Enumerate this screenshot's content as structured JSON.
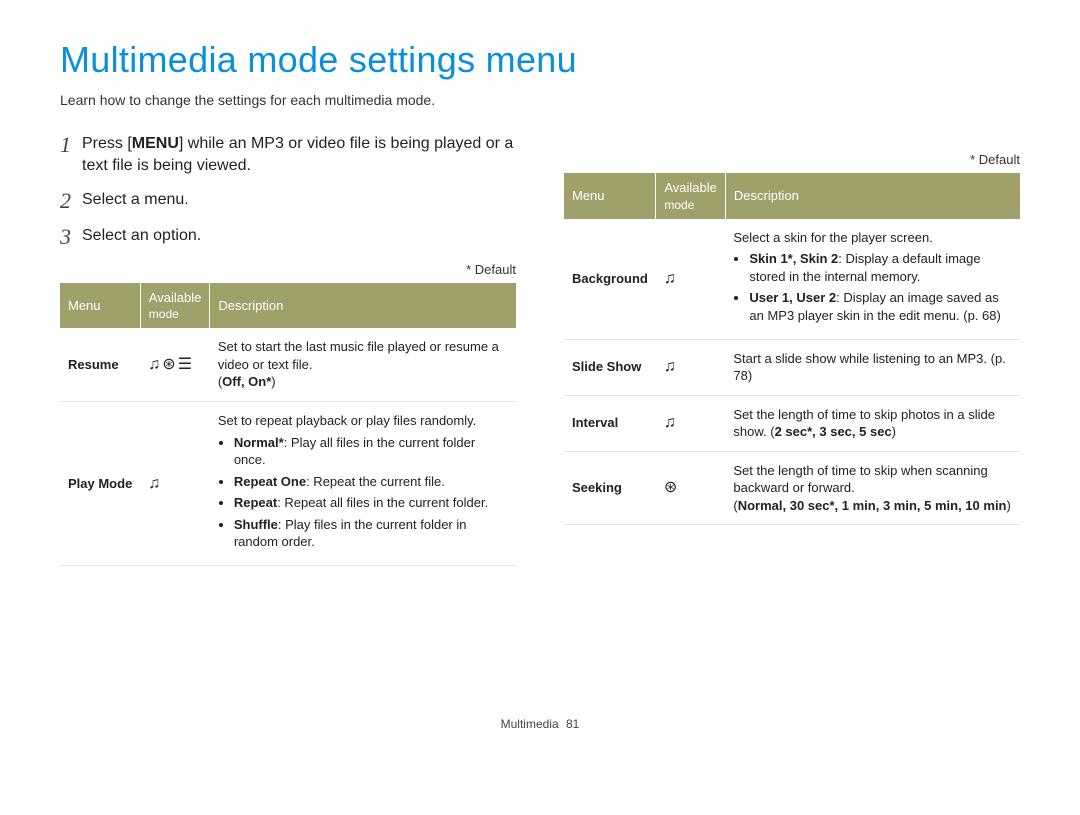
{
  "title": "Multimedia mode settings menu",
  "subtitle": "Learn how to change the settings for each multimedia mode.",
  "default_note": "* Default",
  "footer": {
    "section": "Multimedia",
    "page": "81"
  },
  "icons": {
    "music": "♫",
    "video": "⊛",
    "text": "☰"
  },
  "steps": [
    {
      "num": "1",
      "pre": "Press [",
      "bold": "MENU",
      "post": "] while an MP3 or video file is being played or a text file is being viewed."
    },
    {
      "num": "2",
      "text": "Select a menu."
    },
    {
      "num": "3",
      "text": "Select an option."
    }
  ],
  "table_headers": {
    "menu": "Menu",
    "mode_line1": "Available",
    "mode_line2": "mode",
    "desc": "Description"
  },
  "left_table": [
    {
      "menu": "Resume",
      "mode_icons": [
        "music",
        "video",
        "text"
      ],
      "desc_intro": "Set to start the last music file played or resume a video or text file.",
      "desc_options_inline_prefix": "(",
      "desc_options_inline": "Off, On*",
      "desc_options_inline_suffix": ")"
    },
    {
      "menu": "Play Mode",
      "mode_icons": [
        "music"
      ],
      "desc_intro": "Set to repeat playback or play files randomly.",
      "bullets": [
        {
          "bold": "Normal*",
          "rest": ": Play all files in the current folder once."
        },
        {
          "bold": "Repeat One",
          "rest": ": Repeat the current file."
        },
        {
          "bold": "Repeat",
          "rest": ": Repeat all files in the current folder."
        },
        {
          "bold": "Shuffle",
          "rest": ": Play files in the current folder in random order."
        }
      ]
    }
  ],
  "right_table": [
    {
      "menu": "Background",
      "mode_icons": [
        "music"
      ],
      "desc_intro": "Select a skin for the player screen.",
      "bullets": [
        {
          "bold": "Skin 1*, Skin 2",
          "rest": ": Display a default image stored in the internal memory."
        },
        {
          "bold": "User 1, User 2",
          "rest": ": Display an image saved as an MP3 player skin in the edit menu. (p. 68)"
        }
      ]
    },
    {
      "menu": "Slide Show",
      "mode_icons": [
        "music"
      ],
      "desc_intro": "Start a slide show while listening to an MP3. (p. 78)"
    },
    {
      "menu": "Interval",
      "mode_icons": [
        "music"
      ],
      "desc_intro": "Set the length of time to skip photos in a slide show. (",
      "bold_inline": "2 sec*, 3 sec, 5 sec",
      "desc_after": ")"
    },
    {
      "menu": "Seeking",
      "mode_icons": [
        "video"
      ],
      "desc_intro": "Set the length of time to skip when scanning backward or forward.",
      "bold_line_prefix": "(",
      "bold_line": "Normal, 30 sec*, 1 min, 3 min, 5 min, 10 min",
      "bold_line_suffix": ")"
    }
  ]
}
